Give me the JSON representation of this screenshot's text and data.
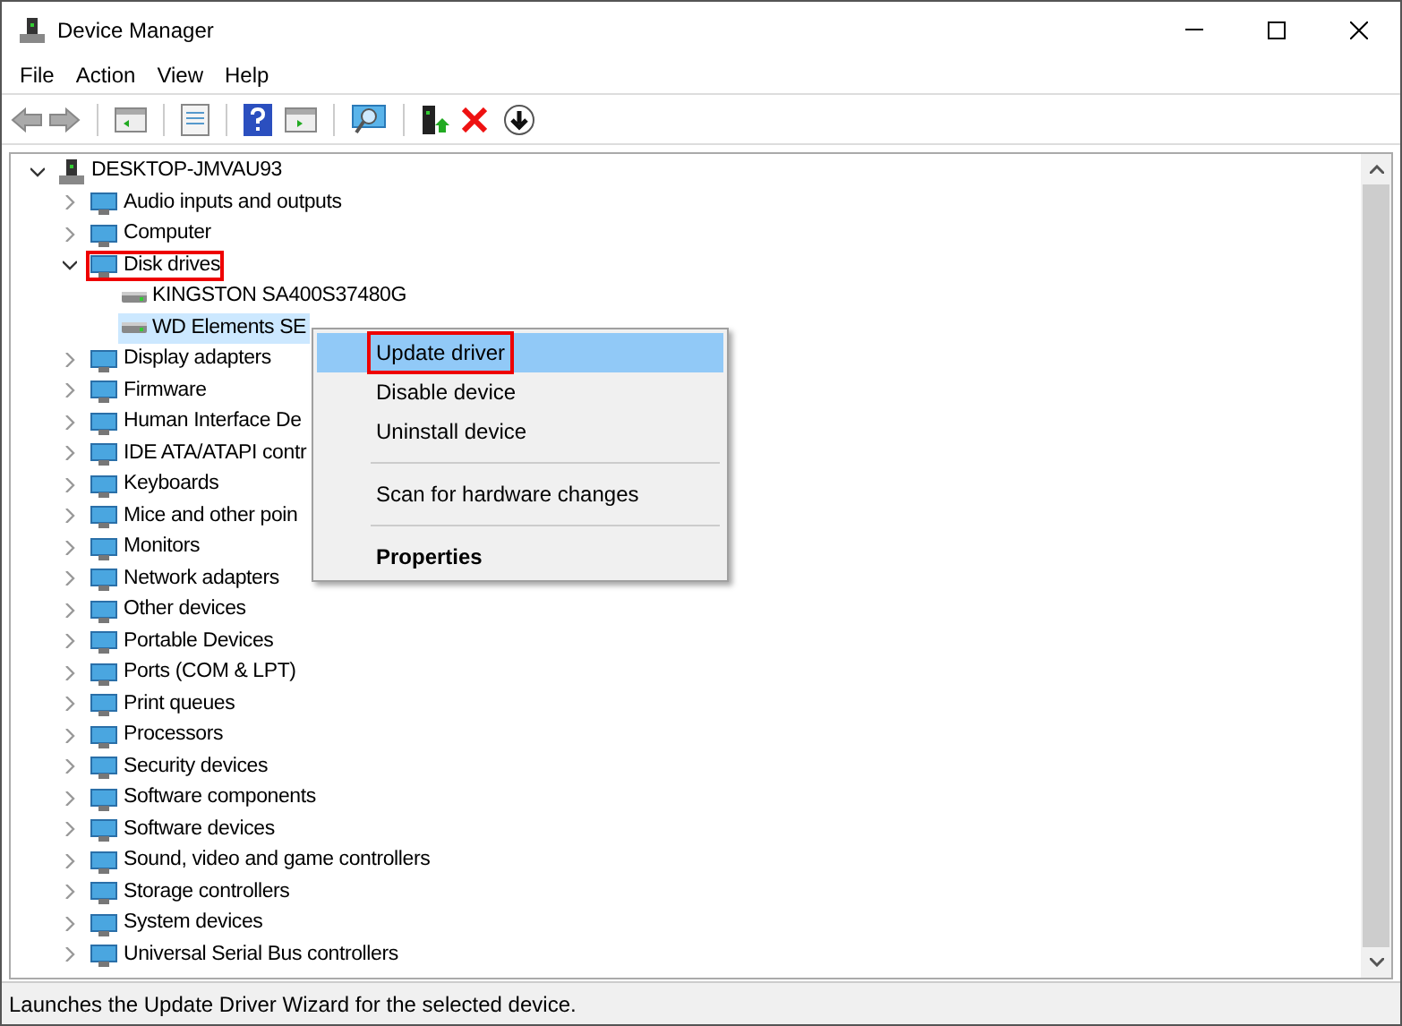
{
  "window": {
    "title": "Device Manager"
  },
  "menu_bar": [
    "File",
    "Action",
    "View",
    "Help"
  ],
  "tree": [
    {
      "label": "DESKTOP-JMVAU93",
      "expanded": true,
      "selected": false,
      "annotated": false,
      "children": [
        {
          "label": "Audio inputs and outputs",
          "expanded": false,
          "selected": false,
          "annotated": false
        },
        {
          "label": "Computer",
          "expanded": false,
          "selected": false,
          "annotated": false
        },
        {
          "label": "Disk drives",
          "expanded": true,
          "selected": false,
          "annotated": true,
          "children": [
            {
              "label": "KINGSTON SA400S37480G",
              "selected": false,
              "annotated": false
            },
            {
              "label": "WD Elements SE",
              "selected": true,
              "annotated": false
            }
          ]
        },
        {
          "label": "Display adapters",
          "expanded": false,
          "selected": false,
          "annotated": false
        },
        {
          "label": "Firmware",
          "expanded": false,
          "selected": false,
          "annotated": false
        },
        {
          "label": "Human Interface De",
          "expanded": false,
          "selected": false,
          "annotated": false
        },
        {
          "label": "IDE ATA/ATAPI contr",
          "expanded": false,
          "selected": false,
          "annotated": false
        },
        {
          "label": "Keyboards",
          "expanded": false,
          "selected": false,
          "annotated": false
        },
        {
          "label": "Mice and other poin",
          "expanded": false,
          "selected": false,
          "annotated": false
        },
        {
          "label": "Monitors",
          "expanded": false,
          "selected": false,
          "annotated": false
        },
        {
          "label": "Network adapters",
          "expanded": false,
          "selected": false,
          "annotated": false
        },
        {
          "label": "Other devices",
          "expanded": false,
          "selected": false,
          "annotated": false
        },
        {
          "label": "Portable Devices",
          "expanded": false,
          "selected": false,
          "annotated": false
        },
        {
          "label": "Ports (COM & LPT)",
          "expanded": false,
          "selected": false,
          "annotated": false
        },
        {
          "label": "Print queues",
          "expanded": false,
          "selected": false,
          "annotated": false
        },
        {
          "label": "Processors",
          "expanded": false,
          "selected": false,
          "annotated": false
        },
        {
          "label": "Security devices",
          "expanded": false,
          "selected": false,
          "annotated": false
        },
        {
          "label": "Software components",
          "expanded": false,
          "selected": false,
          "annotated": false
        },
        {
          "label": "Software devices",
          "expanded": false,
          "selected": false,
          "annotated": false
        },
        {
          "label": "Sound, video and game controllers",
          "expanded": false,
          "selected": false,
          "annotated": false
        },
        {
          "label": "Storage controllers",
          "expanded": false,
          "selected": false,
          "annotated": false
        },
        {
          "label": "System devices",
          "expanded": false,
          "selected": false,
          "annotated": false
        },
        {
          "label": "Universal Serial Bus controllers",
          "expanded": false,
          "selected": false,
          "annotated": false
        }
      ]
    }
  ],
  "context_menu": [
    {
      "kind": "item",
      "label": "Update driver",
      "selected": true,
      "annotated": true,
      "bold": false
    },
    {
      "kind": "item",
      "label": "Disable device",
      "selected": false,
      "annotated": false,
      "bold": false
    },
    {
      "kind": "item",
      "label": "Uninstall device",
      "selected": false,
      "annotated": false,
      "bold": false
    },
    {
      "kind": "separator"
    },
    {
      "kind": "item",
      "label": "Scan for hardware changes",
      "selected": false,
      "annotated": false,
      "bold": false
    },
    {
      "kind": "separator"
    },
    {
      "kind": "item",
      "label": "Properties",
      "selected": false,
      "annotated": false,
      "bold": true
    }
  ],
  "status_bar": "Launches the Update Driver Wizard for the selected device."
}
